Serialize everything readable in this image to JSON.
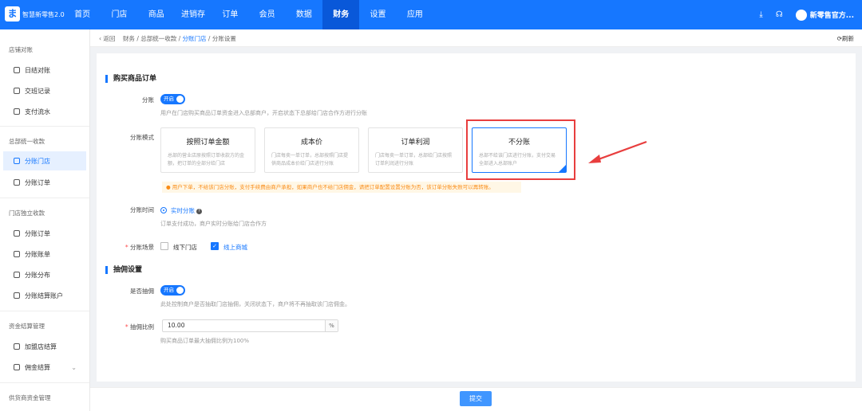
{
  "app": {
    "logo_glyph": "ま",
    "brand": "智慧新零售2.0"
  },
  "nav": {
    "items": [
      "首页",
      "门店",
      "商品",
      "进销存",
      "订单",
      "会员",
      "数据",
      "财务",
      "设置",
      "应用"
    ],
    "active": "财务"
  },
  "top_right": {
    "download_icon": "⤓",
    "headset_icon": "☊",
    "user": "新零售官方..."
  },
  "sidebar": {
    "groups": [
      {
        "title": "店铺对账",
        "items": [
          "日结对账",
          "交班记录",
          "支付流水"
        ]
      },
      {
        "title": "总部统一收款",
        "items": [
          "分账门店",
          "分账订单"
        ]
      },
      {
        "title": "门店独立收款",
        "items": [
          "分账订单",
          "分账账单",
          "分账分布",
          "分账结算账户"
        ]
      },
      {
        "title": "资金结算管理",
        "items": [
          "加盟店结算",
          "佣金结算"
        ]
      },
      {
        "title": "供货商资金管理",
        "items": []
      }
    ],
    "active": "分账门店"
  },
  "breadcrumb": {
    "back": "返回",
    "path": [
      "财务",
      "总部统一收款"
    ],
    "current": "分账门店",
    "tail": "分账设置",
    "refresh": "刷新"
  },
  "section1": {
    "title": "购买商品订单",
    "split_label": "分账",
    "split_toggle": "开启",
    "split_hint": "用户在门店购买商品订单资金进入总部商户，开启状态下总部给门店合作方进行分账",
    "mode_label": "分账模式",
    "modes": [
      {
        "title": "按照订单金额",
        "desc": "总部的营业店原按照订单收款方的金额，把订单的全部分给门店"
      },
      {
        "title": "成本价",
        "desc": "门店每卖一单订单，总部按照门店提供商品成本价给门店进行分账"
      },
      {
        "title": "订单利润",
        "desc": "门店每卖一单订单，总部给门店按照订单利润进行分账"
      },
      {
        "title": "不分账",
        "desc": "总部不给该门店进行分账，支付交易全部进入总部账户"
      }
    ],
    "selected_mode": "不分账",
    "warning": "用户下单，不给该门店分账，支付手续费由商户承担，如果商户也不给门店佣金，请把订单配置设置分账为否，该订单分账失败可以再转账。",
    "time_label": "分账时间",
    "time_option": "实时分账",
    "time_hint": "订单支付成功，商户实时分账给门店合作方",
    "scene_label": "分账场景",
    "scenes": [
      {
        "label": "线下门店",
        "checked": false
      },
      {
        "label": "线上商城",
        "checked": true
      }
    ]
  },
  "section2": {
    "title": "抽佣设置",
    "commission_label": "是否抽佣",
    "commission_toggle": "开启",
    "commission_hint": "此处控制商户是否抽取门店抽佣，关闭状态下，商户将不再抽取该门店佣金。",
    "ratio_label": "抽佣比例",
    "ratio_value": "10.00",
    "ratio_suffix": "%",
    "ratio_hint": "购买商品订单最大抽佣比例为100%"
  },
  "footer": {
    "submit": "提交"
  },
  "colors": {
    "primary": "#1677ff",
    "highlight": "#e83e3e",
    "warning": "#fa8c16"
  }
}
